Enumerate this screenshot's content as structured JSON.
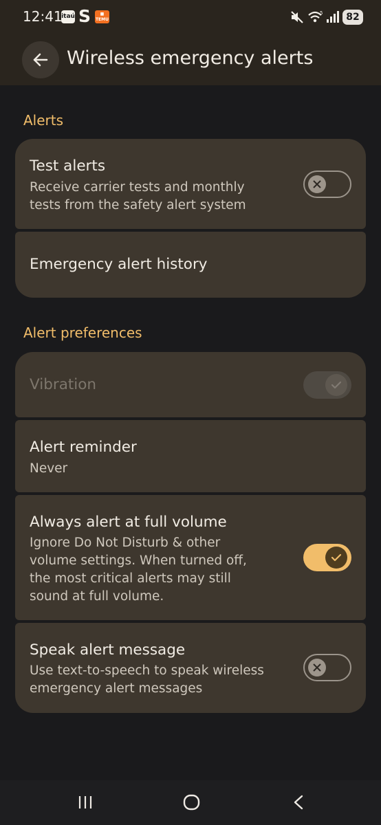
{
  "status_bar": {
    "time": "12:41",
    "apps": [
      "itaú",
      "S",
      "TEMU"
    ],
    "icons": [
      "mute-icon",
      "wifi-icon",
      "signal-icon"
    ],
    "battery": "82"
  },
  "app_bar": {
    "back_icon": "arrow-left-icon",
    "title": "Wireless emergency alerts"
  },
  "sections": {
    "alerts": {
      "header": "Alerts",
      "test_alerts": {
        "title": "Test alerts",
        "summary": "Receive carrier tests and monthly tests from the safety alert system",
        "toggle": "off"
      },
      "history": {
        "title": "Emergency alert history"
      }
    },
    "preferences": {
      "header": "Alert preferences",
      "vibration": {
        "title": "Vibration",
        "toggle": "on",
        "enabled": false
      },
      "reminder": {
        "title": "Alert reminder",
        "value": "Never"
      },
      "full_volume": {
        "title": "Always alert at full volume",
        "summary": "Ignore Do Not Disturb & other volume settings. When turned off, the most critical alerts may still sound at full volume.",
        "toggle": "on"
      },
      "speak": {
        "title": "Speak alert message",
        "summary": "Use text-to-speech to speak wireless emergency alert messages",
        "toggle": "off"
      }
    }
  },
  "nav_bar": {
    "icons": [
      "recents-icon",
      "home-icon",
      "back-icon"
    ]
  },
  "colors": {
    "background": "#1a1a1c",
    "card": "#3e372e",
    "accent": "#f1bd6a",
    "text": "#f1ece4"
  }
}
